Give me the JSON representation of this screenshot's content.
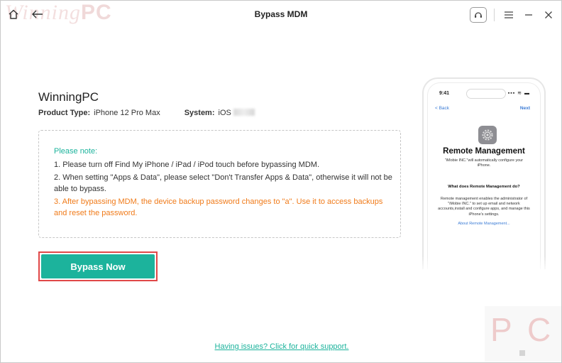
{
  "window": {
    "title": "Bypass MDM",
    "watermark_script": "Winning",
    "watermark_bold": "PC"
  },
  "device": {
    "name": "WinningPC",
    "product_type_label": "Product Type:",
    "product_type_value": "iPhone 12 Pro Max",
    "system_label": "System:",
    "system_value": "iOS"
  },
  "note": {
    "title": "Please note:",
    "items": [
      "1. Please turn off Find My iPhone / iPad / iPod touch before bypassing MDM.",
      "2. When setting \"Apps & Data\", please select \"Don't Transfer Apps & Data\", otherwise it will not be able to bypass.",
      "3. After bypassing MDM, the device backup password changes to \"a\". Use it to access backups and reset the password."
    ]
  },
  "actions": {
    "bypass_label": "Bypass Now",
    "support_link": "Having issues? Click for quick support."
  },
  "phone": {
    "time": "9:41",
    "status": "▪▪▪ ≋ ▬",
    "back": "< Back",
    "next": "Next",
    "title": "Remote Management",
    "subtitle": "\"iMobie INC.\"will automatically configure your iPhone.",
    "question": "What does Remote Management do?",
    "description": "Remote management enables the administrator of \"iMobie INC.\" to set up email and network accounts,install and configure apps, and manage this iPhone's settings.",
    "link": "About Remote Management..."
  },
  "corner_watermark": {
    "p": "P",
    "c": "C"
  },
  "colors": {
    "accent": "#1cb39c",
    "warning": "#f07b1a",
    "highlight_border": "#e04848"
  }
}
